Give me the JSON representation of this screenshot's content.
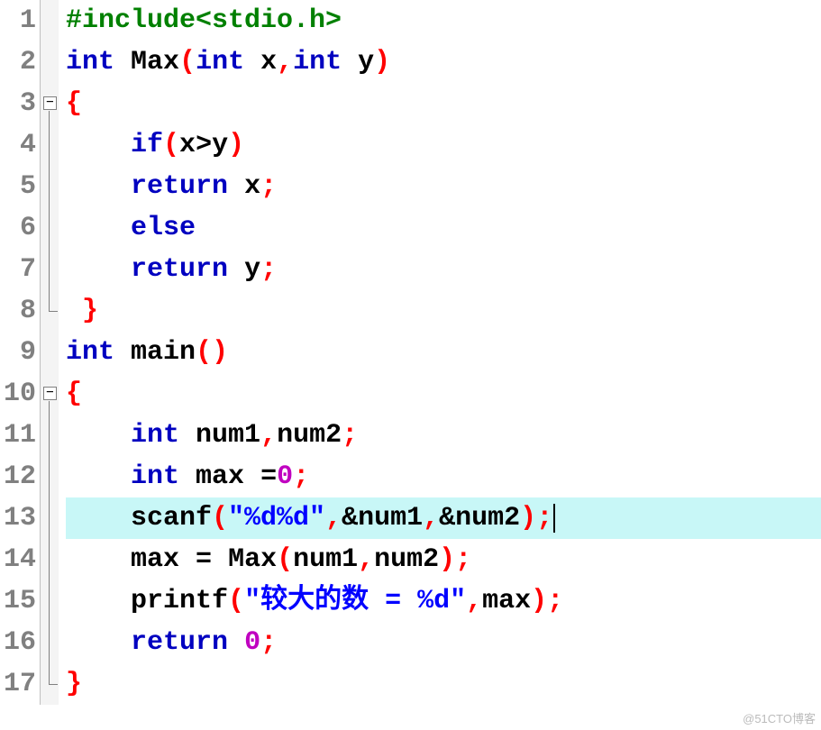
{
  "watermark": "@51CTO博客",
  "highlight_line": 13,
  "fold_markers": [
    {
      "line": 3,
      "type": "open"
    },
    {
      "line": 10,
      "type": "open"
    }
  ],
  "fold_ranges": [
    {
      "from": 3,
      "to": 8
    },
    {
      "from": 10,
      "to": 17
    }
  ],
  "lines": [
    {
      "n": 1,
      "indent": "",
      "tokens": [
        [
          "pre",
          "#include<stdio.h>"
        ]
      ]
    },
    {
      "n": 2,
      "indent": "",
      "tokens": [
        [
          "kw",
          "int"
        ],
        [
          "sp",
          " "
        ],
        [
          "ident",
          "Max"
        ],
        [
          "paren",
          "("
        ],
        [
          "kw",
          "int"
        ],
        [
          "sp",
          " "
        ],
        [
          "ident",
          "x"
        ],
        [
          "comma",
          ","
        ],
        [
          "kw",
          "int"
        ],
        [
          "sp",
          " "
        ],
        [
          "ident",
          "y"
        ],
        [
          "paren",
          ")"
        ]
      ]
    },
    {
      "n": 3,
      "indent": "",
      "tokens": [
        [
          "brace",
          "{"
        ]
      ]
    },
    {
      "n": 4,
      "indent": "    ",
      "tokens": [
        [
          "kw",
          "if"
        ],
        [
          "paren",
          "("
        ],
        [
          "ident",
          "x"
        ],
        [
          "op",
          ">"
        ],
        [
          "ident",
          "y"
        ],
        [
          "paren",
          ")"
        ]
      ]
    },
    {
      "n": 5,
      "indent": "    ",
      "tokens": [
        [
          "kw",
          "return"
        ],
        [
          "sp",
          " "
        ],
        [
          "ident",
          "x"
        ],
        [
          "semi",
          ";"
        ]
      ]
    },
    {
      "n": 6,
      "indent": "    ",
      "tokens": [
        [
          "kw",
          "else"
        ]
      ]
    },
    {
      "n": 7,
      "indent": "    ",
      "tokens": [
        [
          "kw",
          "return"
        ],
        [
          "sp",
          " "
        ],
        [
          "ident",
          "y"
        ],
        [
          "semi",
          ";"
        ]
      ]
    },
    {
      "n": 8,
      "indent": " ",
      "tokens": [
        [
          "brace",
          "}"
        ]
      ]
    },
    {
      "n": 9,
      "indent": "",
      "tokens": [
        [
          "kw",
          "int"
        ],
        [
          "sp",
          " "
        ],
        [
          "ident",
          "main"
        ],
        [
          "paren",
          "("
        ],
        [
          "paren",
          ")"
        ]
      ]
    },
    {
      "n": 10,
      "indent": "",
      "tokens": [
        [
          "brace",
          "{"
        ]
      ]
    },
    {
      "n": 11,
      "indent": "    ",
      "tokens": [
        [
          "kw",
          "int"
        ],
        [
          "sp",
          " "
        ],
        [
          "ident",
          "num1"
        ],
        [
          "comma",
          ","
        ],
        [
          "ident",
          "num2"
        ],
        [
          "semi",
          ";"
        ]
      ]
    },
    {
      "n": 12,
      "indent": "    ",
      "tokens": [
        [
          "kw",
          "int"
        ],
        [
          "sp",
          " "
        ],
        [
          "ident",
          "max"
        ],
        [
          "sp",
          " "
        ],
        [
          "op",
          "="
        ],
        [
          "num",
          "0"
        ],
        [
          "semi",
          ";"
        ]
      ]
    },
    {
      "n": 13,
      "indent": "    ",
      "tokens": [
        [
          "ident",
          "scanf"
        ],
        [
          "paren",
          "("
        ],
        [
          "str",
          "\"%d%d\""
        ],
        [
          "comma",
          ","
        ],
        [
          "op",
          "&"
        ],
        [
          "ident",
          "num1"
        ],
        [
          "comma",
          ","
        ],
        [
          "op",
          "&"
        ],
        [
          "ident",
          "num2"
        ],
        [
          "paren",
          ")"
        ],
        [
          "semi",
          ";"
        ]
      ],
      "cursor_after": true
    },
    {
      "n": 14,
      "indent": "    ",
      "tokens": [
        [
          "ident",
          "max"
        ],
        [
          "sp",
          " "
        ],
        [
          "op",
          "="
        ],
        [
          "sp",
          " "
        ],
        [
          "ident",
          "Max"
        ],
        [
          "paren",
          "("
        ],
        [
          "ident",
          "num1"
        ],
        [
          "comma",
          ","
        ],
        [
          "ident",
          "num2"
        ],
        [
          "paren",
          ")"
        ],
        [
          "semi",
          ";"
        ]
      ]
    },
    {
      "n": 15,
      "indent": "    ",
      "tokens": [
        [
          "ident",
          "printf"
        ],
        [
          "paren",
          "("
        ],
        [
          "str",
          "\"较大的数 = %d\""
        ],
        [
          "comma",
          ","
        ],
        [
          "ident",
          "max"
        ],
        [
          "paren",
          ")"
        ],
        [
          "semi",
          ";"
        ]
      ]
    },
    {
      "n": 16,
      "indent": "    ",
      "tokens": [
        [
          "kw",
          "return"
        ],
        [
          "sp",
          " "
        ],
        [
          "num",
          "0"
        ],
        [
          "semi",
          ";"
        ]
      ]
    },
    {
      "n": 17,
      "indent": "",
      "tokens": [
        [
          "brace",
          "}"
        ]
      ]
    }
  ]
}
